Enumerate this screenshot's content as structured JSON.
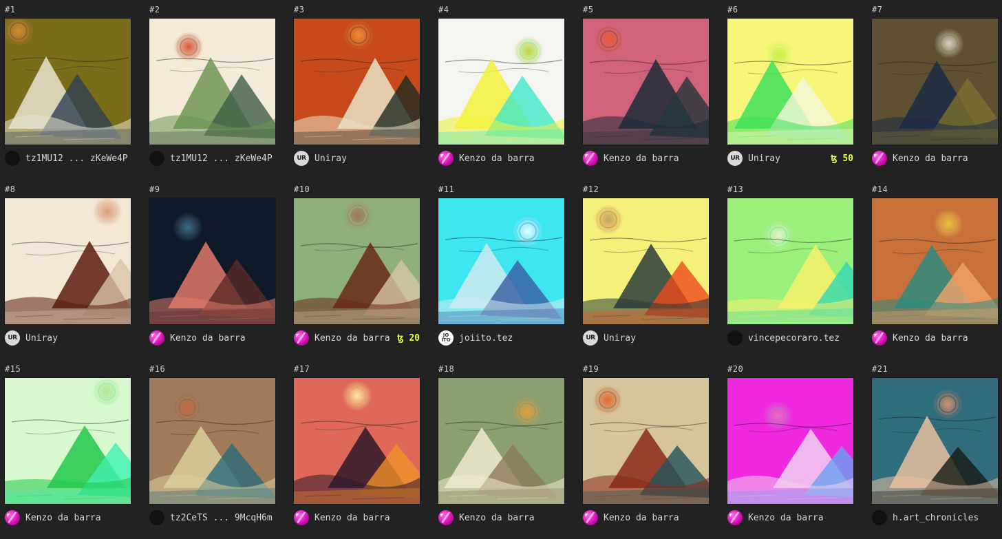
{
  "tokens": [
    {
      "num": "#1",
      "owner": "tz1MU12 ... zKeWe4P",
      "avatar": "dark",
      "price": "",
      "palette": {
        "bg": "#7a6d1a",
        "a": "#e8e4d0",
        "b": "#2e3e52",
        "sun": "#d88a30"
      }
    },
    {
      "num": "#2",
      "owner": "tz1MU12 ... zKeWe4P",
      "avatar": "dark",
      "price": "",
      "palette": {
        "bg": "#f3ead7",
        "a": "#6e9655",
        "b": "#3f5f45",
        "sun": "#d85a3a"
      }
    },
    {
      "num": "#3",
      "owner": "Uniray",
      "avatar": "ur",
      "price": "",
      "palette": {
        "bg": "#c64a1c",
        "a": "#e9e2c5",
        "b": "#1f2a22",
        "sun": "#f08a3a"
      }
    },
    {
      "num": "#4",
      "owner": "Kenzo da barra",
      "avatar": "pink",
      "price": "",
      "palette": {
        "bg": "#f4f4f0",
        "a": "#f1f03a",
        "b": "#40e8c8",
        "sun": "#b8d840"
      }
    },
    {
      "num": "#5",
      "owner": "Kenzo da barra",
      "avatar": "pink",
      "price": "",
      "palette": {
        "bg": "#d0627a",
        "a": "#1d2c3a",
        "b": "#24373c",
        "sun": "#e65a3a"
      }
    },
    {
      "num": "#6",
      "owner": "Uniray",
      "avatar": "ur",
      "price": "ꜩ 50",
      "palette": {
        "bg": "#f6f67a",
        "a": "#3fe05a",
        "b": "#f4f6dc",
        "sun": "#c8f040"
      }
    },
    {
      "num": "#7",
      "owner": "Kenzo da barra",
      "avatar": "pink",
      "price": "",
      "palette": {
        "bg": "#5e5032",
        "a": "#1b2a45",
        "b": "#7a7030",
        "sun": "#d8d0c0"
      }
    },
    {
      "num": "#8",
      "owner": "Uniray",
      "avatar": "ur",
      "price": "",
      "palette": {
        "bg": "#f3e8d6",
        "a": "#5a1c10",
        "b": "#d7c3a9",
        "sun": "#e09a7a"
      }
    },
    {
      "num": "#9",
      "owner": "Kenzo da barra",
      "avatar": "pink",
      "price": "",
      "palette": {
        "bg": "#0e1a28",
        "a": "#e07a6a",
        "b": "#5a2a28",
        "sun": "#3a6a88"
      }
    },
    {
      "num": "#10",
      "owner": "Kenzo da barra",
      "avatar": "pink",
      "price": "ꜩ 20",
      "palette": {
        "bg": "#8fb07a",
        "a": "#6a2818",
        "b": "#d6c6a8",
        "sun": "#9a7a58"
      }
    },
    {
      "num": "#11",
      "owner": "joiito.tez",
      "avatar": "ji",
      "price": "",
      "palette": {
        "bg": "#3ee6f2",
        "a": "#cde9ee",
        "b": "#3a5aa0",
        "sun": "#e4fbff"
      }
    },
    {
      "num": "#12",
      "owner": "Uniray",
      "avatar": "ur",
      "price": "",
      "palette": {
        "bg": "#f4f07a",
        "a": "#2a3c3a",
        "b": "#ef4a1c",
        "sun": "#c8a060"
      }
    },
    {
      "num": "#13",
      "owner": "vincepecoraro.tez",
      "avatar": "dark",
      "price": "",
      "palette": {
        "bg": "#9af07a",
        "a": "#f6f06a",
        "b": "#30d8b0",
        "sun": "#e0f0c8"
      }
    },
    {
      "num": "#14",
      "owner": "Kenzo da barra",
      "avatar": "pink",
      "price": "",
      "palette": {
        "bg": "#c8703a",
        "a": "#2e8a80",
        "b": "#f0a46a",
        "sun": "#e8c040"
      }
    },
    {
      "num": "#15",
      "owner": "Kenzo da barra",
      "avatar": "pink",
      "price": "",
      "palette": {
        "bg": "#d8f8d0",
        "a": "#22c84a",
        "b": "#3ef0b0",
        "sun": "#b0e890"
      }
    },
    {
      "num": "#16",
      "owner": "tz2CeTS ... 9McqH6m",
      "avatar": "dark",
      "price": "",
      "palette": {
        "bg": "#a07a5a",
        "a": "#d8d09a",
        "b": "#2a6a7a",
        "sun": "#c06a40"
      }
    },
    {
      "num": "#17",
      "owner": "Kenzo da barra",
      "avatar": "pink",
      "price": "",
      "palette": {
        "bg": "#e06858",
        "a": "#2e1a2a",
        "b": "#f0902a",
        "sun": "#f8e8a0"
      }
    },
    {
      "num": "#18",
      "owner": "Kenzo da barra",
      "avatar": "pink",
      "price": "",
      "palette": {
        "bg": "#8aa070",
        "a": "#f0ead0",
        "b": "#8a7a5a",
        "sun": "#e0a040"
      }
    },
    {
      "num": "#19",
      "owner": "Kenzo da barra",
      "avatar": "pink",
      "price": "",
      "palette": {
        "bg": "#d6c49a",
        "a": "#8a2a18",
        "b": "#20545a",
        "sun": "#e06a30"
      }
    },
    {
      "num": "#20",
      "owner": "Kenzo da barra",
      "avatar": "pink",
      "price": "",
      "palette": {
        "bg": "#f028e0",
        "a": "#f0d0f0",
        "b": "#6aa0f0",
        "sun": "#e070c0"
      }
    },
    {
      "num": "#21",
      "owner": "h.art_chronicles",
      "avatar": "dark",
      "price": "",
      "palette": {
        "bg": "#2f6c7c",
        "a": "#e8c0a0",
        "b": "#181a14",
        "sun": "#d09070"
      }
    }
  ]
}
